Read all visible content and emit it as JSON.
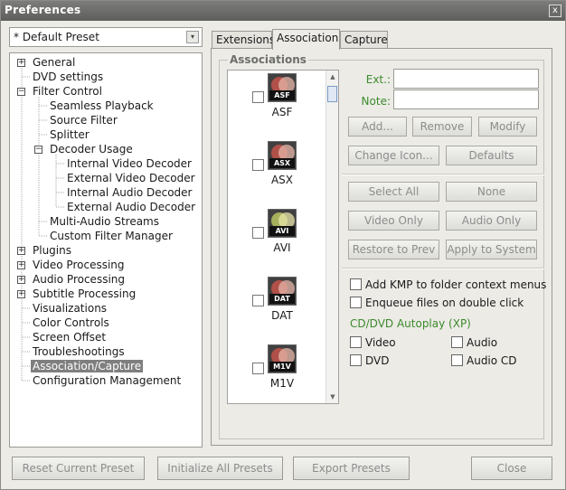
{
  "window": {
    "title": "Preferences",
    "close_glyph": "x"
  },
  "preset_select": {
    "value": "* Default Preset",
    "arrow_glyph": "▾"
  },
  "tree": {
    "items": [
      {
        "label": "General",
        "expander": "+"
      },
      {
        "label": "DVD settings",
        "expander": ""
      },
      {
        "label": "Filter Control",
        "expander": "−"
      },
      {
        "label": "Seamless Playback",
        "expander": ""
      },
      {
        "label": "Source Filter",
        "expander": ""
      },
      {
        "label": "Splitter",
        "expander": ""
      },
      {
        "label": "Decoder Usage",
        "expander": "−"
      },
      {
        "label": "Internal Video Decoder",
        "expander": ""
      },
      {
        "label": "External Video Decoder",
        "expander": ""
      },
      {
        "label": "Internal Audio Decoder",
        "expander": ""
      },
      {
        "label": "External Audio Decoder",
        "expander": ""
      },
      {
        "label": "Multi-Audio Streams",
        "expander": ""
      },
      {
        "label": "Custom Filter Manager",
        "expander": ""
      },
      {
        "label": "Plugins",
        "expander": "+"
      },
      {
        "label": "Video Processing",
        "expander": "+"
      },
      {
        "label": "Audio Processing",
        "expander": "+"
      },
      {
        "label": "Subtitle Processing",
        "expander": "+"
      },
      {
        "label": "Visualizations",
        "expander": ""
      },
      {
        "label": "Color Controls",
        "expander": ""
      },
      {
        "label": "Screen Offset",
        "expander": ""
      },
      {
        "label": "Troubleshootings",
        "expander": ""
      },
      {
        "label": "Association/Capture",
        "expander": "",
        "selected": true
      },
      {
        "label": "Configuration Management",
        "expander": ""
      }
    ]
  },
  "tabs": [
    {
      "label": "Extensions"
    },
    {
      "label": "Association",
      "active": true
    },
    {
      "label": "Capture"
    }
  ],
  "associations": {
    "title": "Associations",
    "items": [
      {
        "ext": "ASF",
        "tag": "ASF",
        "icon": "kmp-file-icon",
        "checked": false
      },
      {
        "ext": "ASX",
        "tag": "ASX",
        "icon": "kmp-file-icon",
        "checked": false
      },
      {
        "ext": "AVI",
        "tag": "AVI",
        "icon": "kmp-file-icon",
        "checked": false
      },
      {
        "ext": "DAT",
        "tag": "DAT",
        "icon": "kmp-file-icon",
        "checked": false
      },
      {
        "ext": "M1V",
        "tag": "M1V",
        "icon": "kmp-file-icon",
        "checked": false
      }
    ],
    "scroll_up_glyph": "▲",
    "scroll_down_glyph": "▼"
  },
  "fields": {
    "ext_label": "Ext.:",
    "ext_value": "",
    "note_label": "Note:",
    "note_value": ""
  },
  "buttons": {
    "add": "Add...",
    "remove": "Remove",
    "modify": "Modify",
    "change_icon": "Change Icon...",
    "defaults": "Defaults",
    "select_all": "Select All",
    "none": "None",
    "video_only": "Video Only",
    "audio_only": "Audio Only",
    "restore_to_prev": "Restore to Prev",
    "apply_to_system": "Apply to System"
  },
  "options": {
    "add_kmp_context": {
      "label": "Add KMP to folder context menus",
      "checked": false
    },
    "enqueue_double_click": {
      "label": "Enqueue files on double click",
      "checked": false
    }
  },
  "autoplay": {
    "title": "CD/DVD Autoplay (XP)",
    "video": {
      "label": "Video",
      "checked": false
    },
    "audio": {
      "label": "Audio",
      "checked": false
    },
    "dvd": {
      "label": "DVD",
      "checked": false
    },
    "audio_cd": {
      "label": "Audio CD",
      "checked": false
    }
  },
  "footer": {
    "reset_current_preset": "Reset Current Preset",
    "initialize_all_presets": "Initialize All Presets",
    "export_presets": "Export Presets",
    "close": "Close"
  },
  "colors": {
    "accent_green": "#3c8a2c",
    "selection_gray": "#7f7f7f",
    "titlebar": "#6b6b69"
  }
}
